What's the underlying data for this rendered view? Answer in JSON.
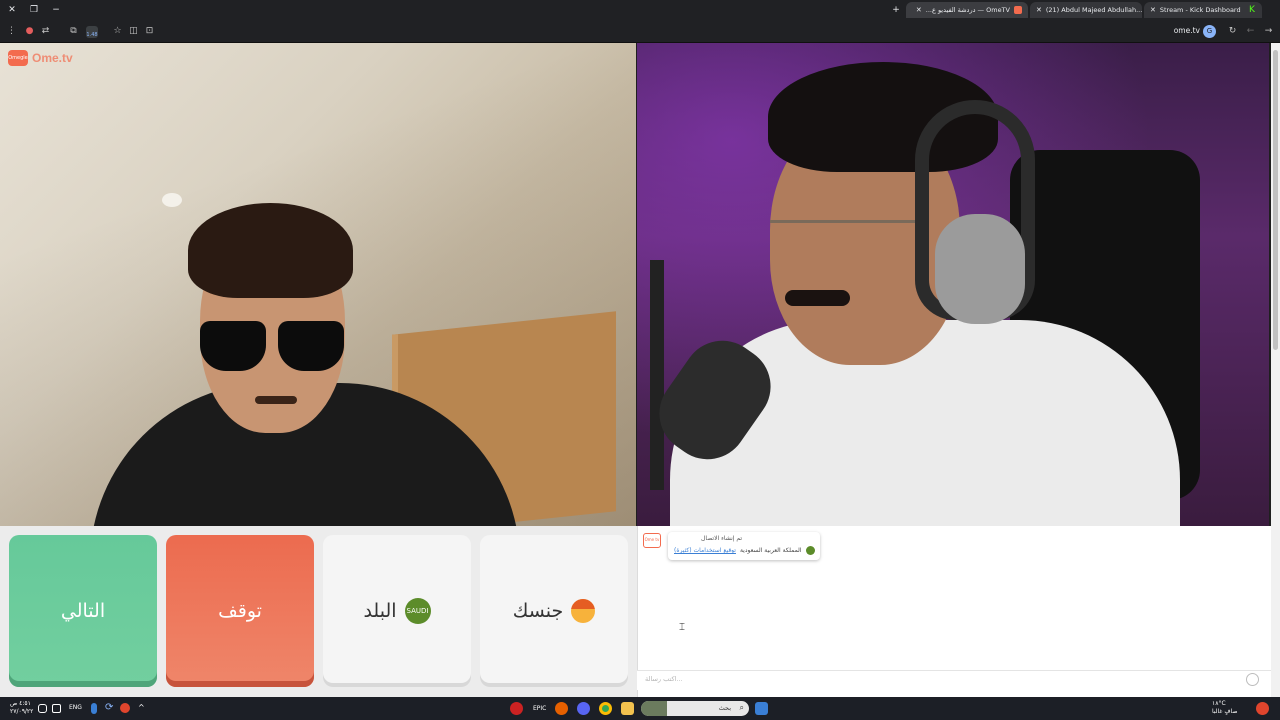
{
  "browser": {
    "tabs": [
      {
        "label": "OmeTV — دردشة الفيديو ع...",
        "favicon_color": "#f36b4e"
      },
      {
        "label": "(21) Abdul Majeed Abdullah...",
        "favicon_color": "#ff0000"
      },
      {
        "label": "Stream - Kick Dashboard",
        "favicon_color": "#53fc18"
      }
    ],
    "address_text": "ome.tv",
    "extension_badge": "1.48"
  },
  "app": {
    "logo_text": "Ome.tv",
    "logo_icon_text": "Omegle"
  },
  "controls": {
    "next_label": "التالي",
    "stop_label": "توقف",
    "country_label": "البلد",
    "country_icon_text": "SAUDI",
    "gender_label": "جنسك"
  },
  "chat": {
    "logo_icon_text": "Ome tv",
    "message_line1": "تم إنشاء الاتصال",
    "message_country": "المملكة العربية السعودية",
    "message_link": "توقيع استخدامات (كثيرة)",
    "input_placeholder": "اكتب رسالة..."
  },
  "taskbar": {
    "search_label": "بحث",
    "language": "ENG",
    "time": "٤:٥١ ص",
    "date": "٢٧/٠٩/٢٢",
    "weather_temp": "١٨°C",
    "weather_text": "صافٍ غالبا"
  },
  "colors": {
    "next_green": "#66c99a",
    "stop_red": "#ec6b4f",
    "brand_orange": "#f36b4e"
  }
}
